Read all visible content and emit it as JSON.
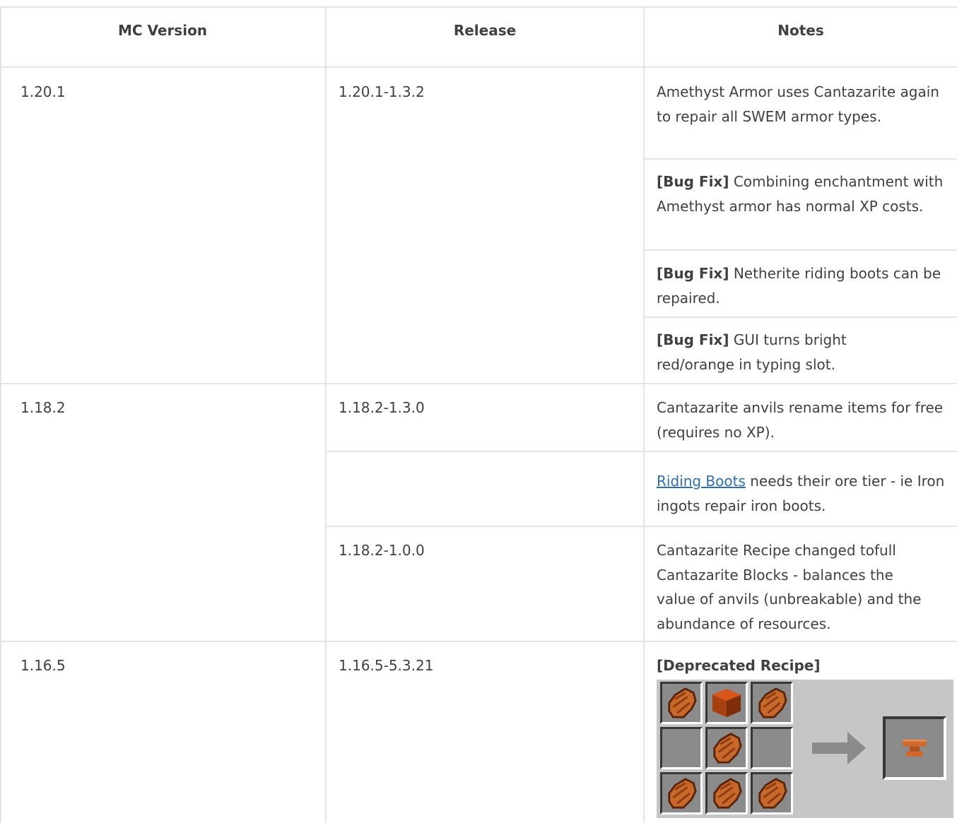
{
  "headers": {
    "mc_version": "MC Version",
    "release": "Release",
    "notes": "Notes"
  },
  "rows": {
    "r1": {
      "version": "1.20.1",
      "release": "1.20.1-1.3.2",
      "note1": "Amethyst Armor uses Cantazarite again to repair all SWEM armor types.",
      "note2_tag": "[Bug Fix]",
      "note2_text": " Combining enchantment with Amethyst armor has normal XP costs.",
      "note3_tag": "[Bug Fix]",
      "note3_text": " Netherite riding boots can be repaired.",
      "note4_tag": "[Bug Fix]",
      "note4_text": " GUI turns bright red/orange in typing slot."
    },
    "r2": {
      "version": "1.18.2",
      "release": "1.18.2-1.3.0",
      "note1": "Cantazarite anvils rename items for free (requires no XP).",
      "note2_link": "Riding Boots",
      "note2_text": " needs their ore tier - ie Iron ingots repair iron boots.",
      "release3": "1.18.2-1.0.0",
      "note3": "Cantazarite Recipe changed tofull Cantazarite Blocks - balances the value of anvils (unbreakable) and the abundance of resources."
    },
    "r3": {
      "version": "1.16.5",
      "release": "1.16.5-5.3.21",
      "note_tag": "[Deprecated Recipe]"
    }
  },
  "recipe": {
    "grid": [
      "cantazarite-gem",
      "cantazarite-block",
      "cantazarite-gem",
      "empty",
      "cantazarite-gem",
      "empty",
      "cantazarite-gem",
      "cantazarite-gem",
      "cantazarite-gem"
    ],
    "output": "cantazarite-anvil"
  },
  "colors": {
    "link": "#2d6fae",
    "gem": "#c8682a",
    "block": "#b0420c",
    "slot_bg": "#8b8b8b",
    "panel_bg": "#c6c6c6"
  }
}
